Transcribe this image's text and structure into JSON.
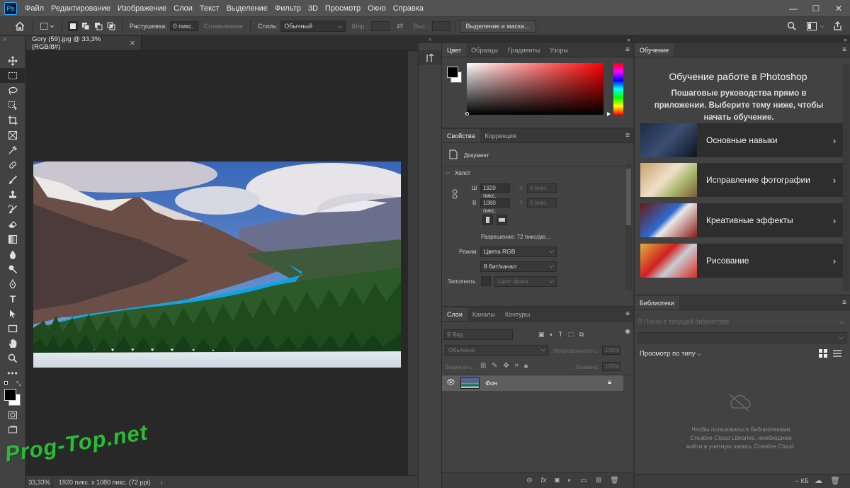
{
  "app": {
    "logo": "Ps"
  },
  "menu": [
    "Файл",
    "Редактирование",
    "Изображение",
    "Слои",
    "Текст",
    "Выделение",
    "Фильтр",
    "3D",
    "Просмотр",
    "Окно",
    "Справка"
  ],
  "window_controls": {
    "minimize": "—",
    "maximize": "☐",
    "close": "✕"
  },
  "options": {
    "feather_label": "Растушевка:",
    "feather_value": "0 пикс.",
    "antialias_label": "Сглаживание",
    "style_label": "Стиль:",
    "style_value": "Обычный",
    "width_label": "Шир.:",
    "height_label": "Выс.:",
    "select_mask_button": "Выделение и маска..."
  },
  "document": {
    "tab_title": "Gory (59).jpg @ 33,3% (RGB/8#)",
    "zoom": "33,33%",
    "status_info": "1920 пикс. x 1080 пикс. (72 ppi)",
    "status_arrow": "›"
  },
  "watermark": "Prog-Top.net",
  "color_panel": {
    "tabs": [
      "Цвет",
      "Образцы",
      "Градиенты",
      "Узоры"
    ],
    "foreground": "#000000",
    "background": "#ffffff",
    "hue": "#ff0000"
  },
  "properties_panel": {
    "tabs": [
      "Свойства",
      "Коррекция"
    ],
    "doc_label": "Документ",
    "section": "Холст",
    "w_label": "Ш",
    "w_value": "1920 пикс.",
    "h_label": "В",
    "h_value": "1080 пикс.",
    "x_label": "X",
    "x_value": "0 пикс.",
    "y_label": "Y",
    "y_value": "0 пикс.",
    "resolution": "Разрешение: 72 пикс/дю...",
    "mode_label": "Режим",
    "mode_value": "Цвета RGB",
    "bitdepth_value": "8 бит/канал",
    "fill_label": "Заполнить",
    "fill_value": "Цвет фона"
  },
  "layers_panel": {
    "tabs": [
      "Слои",
      "Каналы",
      "Контуры"
    ],
    "search_placeholder": "Вид",
    "blend_mode": "Обычные",
    "opacity_label": "Непрозрачность:",
    "opacity_value": "100%",
    "lock_label": "Закрепить:",
    "fill_label": "Заливка:",
    "fill_value": "100%",
    "layer_name": "Фон"
  },
  "learn_panel": {
    "tab": "Обучение",
    "title": "Обучение работе в Photoshop",
    "subtitle": "Пошаговые руководства прямо в приложении. Выберите тему ниже, чтобы начать обучение.",
    "cards": [
      {
        "label": "Основные навыки"
      },
      {
        "label": "Исправление фотографии"
      },
      {
        "label": "Креативные эффекты"
      },
      {
        "label": "Рисование"
      }
    ]
  },
  "libraries_panel": {
    "tab": "Библиотеки",
    "search_placeholder": "Поиск в текущей библиотеке",
    "view_by_type": "Просмотр по типу",
    "message": "Чтобы пользоваться библиотеками Creative Cloud Libraries, необходимо войти в учетную запись Creative Cloud.",
    "size_label": "-- КБ"
  }
}
